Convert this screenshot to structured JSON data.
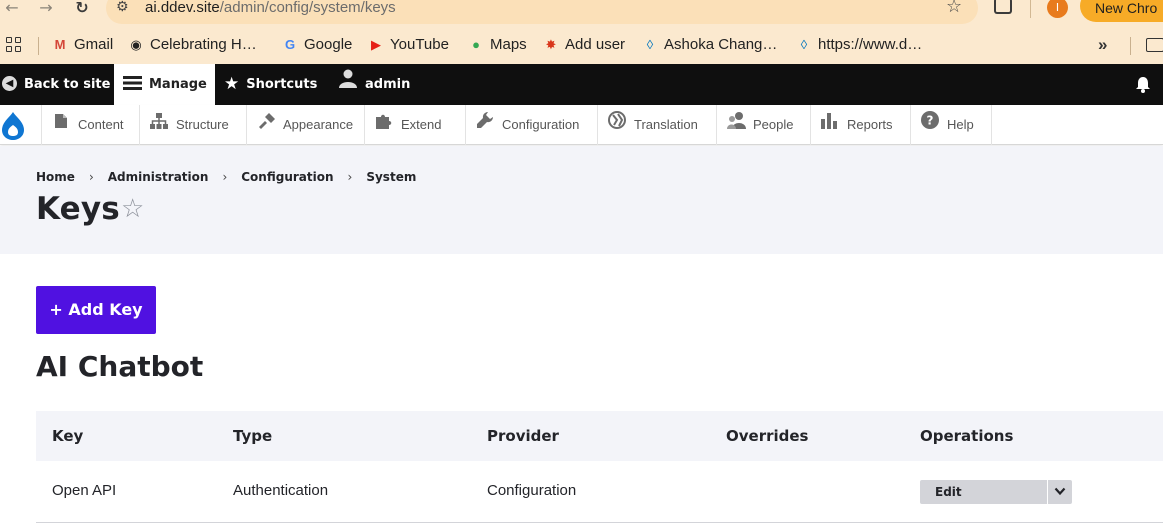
{
  "browser": {
    "url_host": "ai.ddev.site",
    "url_path": "/admin/config/system/keys",
    "profile_initial": "I",
    "new_chrome_label": "New Chro"
  },
  "bookmarks": [
    {
      "label": "Gmail",
      "icon": "gmail-icon"
    },
    {
      "label": "Celebrating H…",
      "icon": "globe-icon"
    },
    {
      "label": "Google",
      "icon": "google-icon"
    },
    {
      "label": "YouTube",
      "icon": "youtube-icon"
    },
    {
      "label": "Maps",
      "icon": "maps-icon"
    },
    {
      "label": "Add user",
      "icon": "drupal-icon"
    },
    {
      "label": "Ashoka Chang…",
      "icon": "drupal-icon"
    },
    {
      "label": "https://www.d…",
      "icon": "drupal-icon"
    }
  ],
  "toolbar": {
    "back_label": "Back to site",
    "manage_label": "Manage",
    "shortcuts_label": "Shortcuts",
    "user_label": "admin"
  },
  "tray": [
    {
      "label": "Content",
      "icon": "content-icon"
    },
    {
      "label": "Structure",
      "icon": "structure-icon"
    },
    {
      "label": "Appearance",
      "icon": "appearance-icon"
    },
    {
      "label": "Extend",
      "icon": "extend-icon"
    },
    {
      "label": "Configuration",
      "icon": "wrench-icon"
    },
    {
      "label": "Translation",
      "icon": "translation-icon"
    },
    {
      "label": "People",
      "icon": "people-icon"
    },
    {
      "label": "Reports",
      "icon": "reports-icon"
    },
    {
      "label": "Help",
      "icon": "help-icon"
    }
  ],
  "breadcrumb": [
    "Home",
    "Administration",
    "Configuration",
    "System"
  ],
  "page_title": "Keys",
  "add_button_label": "+ Add Key",
  "section_title": "AI Chatbot",
  "table": {
    "headers": [
      "Key",
      "Type",
      "Provider",
      "Overrides",
      "Operations"
    ],
    "rows": [
      {
        "key": "Open API",
        "type": "Authentication",
        "provider": "Configuration",
        "overrides": "",
        "operation": "Edit"
      }
    ]
  },
  "colors": {
    "primary_button": "#5011e1",
    "toolbar_bg": "#0f0f0f",
    "header_bg": "#f3f4f9",
    "chrome_bg": "#fbe9cf"
  }
}
